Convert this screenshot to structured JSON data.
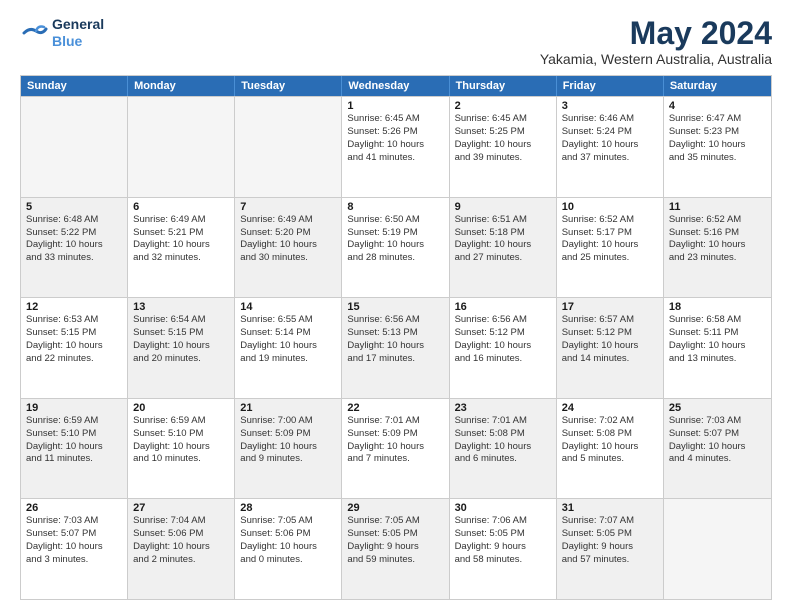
{
  "logo": {
    "line1": "General",
    "line2": "Blue"
  },
  "title": "May 2024",
  "subtitle": "Yakamia, Western Australia, Australia",
  "header_days": [
    "Sunday",
    "Monday",
    "Tuesday",
    "Wednesday",
    "Thursday",
    "Friday",
    "Saturday"
  ],
  "rows": [
    [
      {
        "day": "",
        "lines": [],
        "empty": true
      },
      {
        "day": "",
        "lines": [],
        "empty": true
      },
      {
        "day": "",
        "lines": [],
        "empty": true
      },
      {
        "day": "1",
        "lines": [
          "Sunrise: 6:45 AM",
          "Sunset: 5:26 PM",
          "Daylight: 10 hours",
          "and 41 minutes."
        ]
      },
      {
        "day": "2",
        "lines": [
          "Sunrise: 6:45 AM",
          "Sunset: 5:25 PM",
          "Daylight: 10 hours",
          "and 39 minutes."
        ]
      },
      {
        "day": "3",
        "lines": [
          "Sunrise: 6:46 AM",
          "Sunset: 5:24 PM",
          "Daylight: 10 hours",
          "and 37 minutes."
        ]
      },
      {
        "day": "4",
        "lines": [
          "Sunrise: 6:47 AM",
          "Sunset: 5:23 PM",
          "Daylight: 10 hours",
          "and 35 minutes."
        ]
      }
    ],
    [
      {
        "day": "5",
        "lines": [
          "Sunrise: 6:48 AM",
          "Sunset: 5:22 PM",
          "Daylight: 10 hours",
          "and 33 minutes."
        ],
        "shaded": true
      },
      {
        "day": "6",
        "lines": [
          "Sunrise: 6:49 AM",
          "Sunset: 5:21 PM",
          "Daylight: 10 hours",
          "and 32 minutes."
        ]
      },
      {
        "day": "7",
        "lines": [
          "Sunrise: 6:49 AM",
          "Sunset: 5:20 PM",
          "Daylight: 10 hours",
          "and 30 minutes."
        ],
        "shaded": true
      },
      {
        "day": "8",
        "lines": [
          "Sunrise: 6:50 AM",
          "Sunset: 5:19 PM",
          "Daylight: 10 hours",
          "and 28 minutes."
        ]
      },
      {
        "day": "9",
        "lines": [
          "Sunrise: 6:51 AM",
          "Sunset: 5:18 PM",
          "Daylight: 10 hours",
          "and 27 minutes."
        ],
        "shaded": true
      },
      {
        "day": "10",
        "lines": [
          "Sunrise: 6:52 AM",
          "Sunset: 5:17 PM",
          "Daylight: 10 hours",
          "and 25 minutes."
        ]
      },
      {
        "day": "11",
        "lines": [
          "Sunrise: 6:52 AM",
          "Sunset: 5:16 PM",
          "Daylight: 10 hours",
          "and 23 minutes."
        ],
        "shaded": true
      }
    ],
    [
      {
        "day": "12",
        "lines": [
          "Sunrise: 6:53 AM",
          "Sunset: 5:15 PM",
          "Daylight: 10 hours",
          "and 22 minutes."
        ]
      },
      {
        "day": "13",
        "lines": [
          "Sunrise: 6:54 AM",
          "Sunset: 5:15 PM",
          "Daylight: 10 hours",
          "and 20 minutes."
        ],
        "shaded": true
      },
      {
        "day": "14",
        "lines": [
          "Sunrise: 6:55 AM",
          "Sunset: 5:14 PM",
          "Daylight: 10 hours",
          "and 19 minutes."
        ]
      },
      {
        "day": "15",
        "lines": [
          "Sunrise: 6:56 AM",
          "Sunset: 5:13 PM",
          "Daylight: 10 hours",
          "and 17 minutes."
        ],
        "shaded": true
      },
      {
        "day": "16",
        "lines": [
          "Sunrise: 6:56 AM",
          "Sunset: 5:12 PM",
          "Daylight: 10 hours",
          "and 16 minutes."
        ]
      },
      {
        "day": "17",
        "lines": [
          "Sunrise: 6:57 AM",
          "Sunset: 5:12 PM",
          "Daylight: 10 hours",
          "and 14 minutes."
        ],
        "shaded": true
      },
      {
        "day": "18",
        "lines": [
          "Sunrise: 6:58 AM",
          "Sunset: 5:11 PM",
          "Daylight: 10 hours",
          "and 13 minutes."
        ]
      }
    ],
    [
      {
        "day": "19",
        "lines": [
          "Sunrise: 6:59 AM",
          "Sunset: 5:10 PM",
          "Daylight: 10 hours",
          "and 11 minutes."
        ],
        "shaded": true
      },
      {
        "day": "20",
        "lines": [
          "Sunrise: 6:59 AM",
          "Sunset: 5:10 PM",
          "Daylight: 10 hours",
          "and 10 minutes."
        ]
      },
      {
        "day": "21",
        "lines": [
          "Sunrise: 7:00 AM",
          "Sunset: 5:09 PM",
          "Daylight: 10 hours",
          "and 9 minutes."
        ],
        "shaded": true
      },
      {
        "day": "22",
        "lines": [
          "Sunrise: 7:01 AM",
          "Sunset: 5:09 PM",
          "Daylight: 10 hours",
          "and 7 minutes."
        ]
      },
      {
        "day": "23",
        "lines": [
          "Sunrise: 7:01 AM",
          "Sunset: 5:08 PM",
          "Daylight: 10 hours",
          "and 6 minutes."
        ],
        "shaded": true
      },
      {
        "day": "24",
        "lines": [
          "Sunrise: 7:02 AM",
          "Sunset: 5:08 PM",
          "Daylight: 10 hours",
          "and 5 minutes."
        ]
      },
      {
        "day": "25",
        "lines": [
          "Sunrise: 7:03 AM",
          "Sunset: 5:07 PM",
          "Daylight: 10 hours",
          "and 4 minutes."
        ],
        "shaded": true
      }
    ],
    [
      {
        "day": "26",
        "lines": [
          "Sunrise: 7:03 AM",
          "Sunset: 5:07 PM",
          "Daylight: 10 hours",
          "and 3 minutes."
        ]
      },
      {
        "day": "27",
        "lines": [
          "Sunrise: 7:04 AM",
          "Sunset: 5:06 PM",
          "Daylight: 10 hours",
          "and 2 minutes."
        ],
        "shaded": true
      },
      {
        "day": "28",
        "lines": [
          "Sunrise: 7:05 AM",
          "Sunset: 5:06 PM",
          "Daylight: 10 hours",
          "and 0 minutes."
        ]
      },
      {
        "day": "29",
        "lines": [
          "Sunrise: 7:05 AM",
          "Sunset: 5:05 PM",
          "Daylight: 9 hours",
          "and 59 minutes."
        ],
        "shaded": true
      },
      {
        "day": "30",
        "lines": [
          "Sunrise: 7:06 AM",
          "Sunset: 5:05 PM",
          "Daylight: 9 hours",
          "and 58 minutes."
        ]
      },
      {
        "day": "31",
        "lines": [
          "Sunrise: 7:07 AM",
          "Sunset: 5:05 PM",
          "Daylight: 9 hours",
          "and 57 minutes."
        ],
        "shaded": true
      },
      {
        "day": "",
        "lines": [],
        "empty": true
      }
    ]
  ]
}
